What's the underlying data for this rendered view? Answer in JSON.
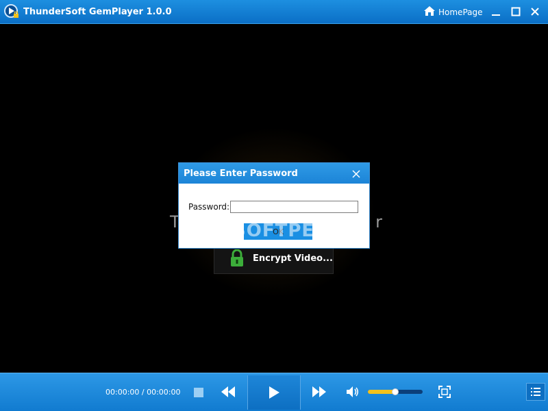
{
  "window": {
    "title": "ThunderSoft GemPlayer 1.0.0",
    "homepage_label": "HomePage",
    "icons": {
      "logo": "app-logo-icon",
      "home": "home-icon",
      "minimize": "minimize-icon",
      "maximize": "maximize-icon",
      "close": "close-icon"
    }
  },
  "video_area": {
    "caption_left": "T",
    "caption_right": "r",
    "encrypt_button_label": "Encrypt Video...",
    "encrypt_icon": "lock-icon"
  },
  "dialog": {
    "title": "Please Enter Password",
    "password_label": "Password:",
    "password_value": "",
    "ok_label": "OK",
    "close_icon": "close-icon"
  },
  "watermark": "SOFTPEDIA",
  "controls": {
    "time": "00:00:00 / 00:00:00",
    "volume_fraction": 0.5,
    "icons": {
      "stop": "stop-icon",
      "rewind": "rewind-icon",
      "play": "play-icon",
      "forward": "fast-forward-icon",
      "volume": "volume-icon",
      "fullscreen": "fullscreen-icon",
      "playlist": "playlist-icon"
    }
  },
  "colors": {
    "accent": "#1a8fe3",
    "volume_fill": "#f4c21c",
    "lock_green": "#3cae3a"
  }
}
